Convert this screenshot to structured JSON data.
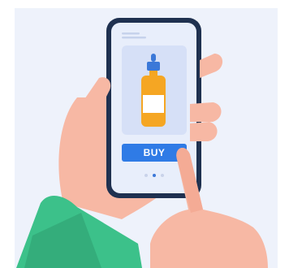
{
  "product_card": {
    "buy_button_label": "BUY"
  },
  "carousel": {
    "dot_count": 3,
    "active_index": 1
  },
  "colors": {
    "background": "#eef2fb",
    "phone_frame": "#1f3150",
    "screen": "#e8eefb",
    "product_panel": "#d6e0f7",
    "bottle": "#f5a623",
    "dropper": "#3b78d8",
    "buy_button": "#2f7be6",
    "skin": "#f7b8a4",
    "sleeve": "#3cc18a"
  },
  "icons": [
    "dropper-bottle-icon"
  ]
}
